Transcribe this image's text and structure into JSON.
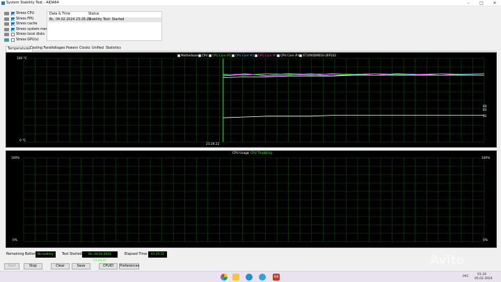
{
  "window": {
    "title": "System Stability Test - AIDA64"
  },
  "options": [
    {
      "label": "Stress CPU",
      "checked": true,
      "icon": "cpu-icon"
    },
    {
      "label": "Stress FPU",
      "checked": true,
      "icon": "fpu-icon"
    },
    {
      "label": "Stress cache",
      "checked": true,
      "icon": "cache-icon"
    },
    {
      "label": "Stress system memory",
      "checked": true,
      "icon": "memory-icon"
    },
    {
      "label": "Stress local disks",
      "checked": false,
      "icon": "disk-icon"
    },
    {
      "label": "Stress GPU(s)",
      "checked": false,
      "icon": "gpu-icon"
    }
  ],
  "status_table": {
    "headers": [
      "Date & Time",
      "Status"
    ],
    "rows": [
      [
        "Вс, 04.02.2024 23:26:22",
        "Stability Test: Started"
      ]
    ]
  },
  "tabs": [
    "Temperatures",
    "Cooling Fans",
    "Voltages",
    "Powers",
    "Clocks",
    "Unified",
    "Statistics"
  ],
  "active_tab": "Temperatures",
  "temp_chart": {
    "legend": [
      {
        "label": "Motherboard",
        "color": "#ffffff",
        "checked": false
      },
      {
        "label": "CPU",
        "color": "#ffffff",
        "checked": false
      },
      {
        "label": "CPU Core #1",
        "color": "#33ff33",
        "checked": true
      },
      {
        "label": "CPU Core #2",
        "color": "#66ccff",
        "checked": true
      },
      {
        "label": "CPU Core #3",
        "color": "#ff44ff",
        "checked": true
      },
      {
        "label": "CPU Core #4",
        "color": "#ffffff",
        "checked": true
      },
      {
        "label": "ST1000DM010-2EP102",
        "color": "#ffffff",
        "checked": true
      }
    ],
    "y_max_label": "100 °C",
    "y_min_label": "0 °C",
    "x_label": "23:26:22",
    "right_values": [
      "80",
      "82",
      "32"
    ]
  },
  "chart_data": [
    {
      "type": "line",
      "title": "",
      "ylim": [
        0,
        100
      ],
      "y_unit": "°C",
      "start_time": "23:26:22",
      "series": [
        {
          "name": "CPU Core #1",
          "color": "#33ff33",
          "values": [
            81,
            80,
            82,
            81,
            80,
            82,
            81,
            82,
            81,
            80,
            82,
            81,
            82
          ]
        },
        {
          "name": "CPU Core #2",
          "color": "#66ccff",
          "values": [
            79,
            81,
            80,
            82,
            81,
            79,
            81,
            80,
            82,
            81,
            80,
            81,
            82
          ]
        },
        {
          "name": "CPU Core #3",
          "color": "#ff44ff",
          "values": [
            80,
            82,
            79,
            80,
            82,
            81,
            80,
            82,
            80,
            81,
            82,
            80,
            80
          ]
        },
        {
          "name": "CPU Core #4",
          "color": "#ffffff",
          "values": [
            77,
            78,
            78,
            79,
            79,
            79,
            80,
            80,
            80,
            80,
            80,
            80,
            80
          ]
        },
        {
          "name": "ST1000DM010-2EP102",
          "color": "#ffffff",
          "values": [
            29,
            30,
            31,
            31,
            31,
            32,
            32,
            32,
            32,
            32,
            32,
            32,
            32
          ]
        }
      ]
    },
    {
      "type": "line",
      "title": "",
      "ylim": [
        0,
        100
      ],
      "y_unit": "%",
      "series": [
        {
          "name": "CPU Usage",
          "color": "#ffffff",
          "values": []
        },
        {
          "name": "CPU Throttling",
          "color": "#33ff33",
          "values": []
        }
      ]
    }
  ],
  "usage_chart": {
    "label_usage": "CPU Usage",
    "label_sep": "|",
    "label_throttle": "CPU Throttling",
    "y_max_label": "100%",
    "y_min_label": "0%",
    "right_max": "100%",
    "right_min": "0%"
  },
  "bottom": {
    "battery_label": "Remaining Battery:",
    "battery_value": "No battery",
    "started_label": "Test Started:",
    "started_value": "Вс, 04.02.2024 23:26:22",
    "elapsed_label": "Elapsed Time:",
    "elapsed_value": "01:25:11"
  },
  "buttons": {
    "start": "Start",
    "stop": "Stop",
    "clear": "Clear",
    "save": "Save",
    "cpuid": "CPUID",
    "preferences": "Preferences"
  },
  "taskbar": {
    "lang": "РУС",
    "time": "01:34",
    "date": "05.02.2024",
    "app_badge": "64"
  }
}
